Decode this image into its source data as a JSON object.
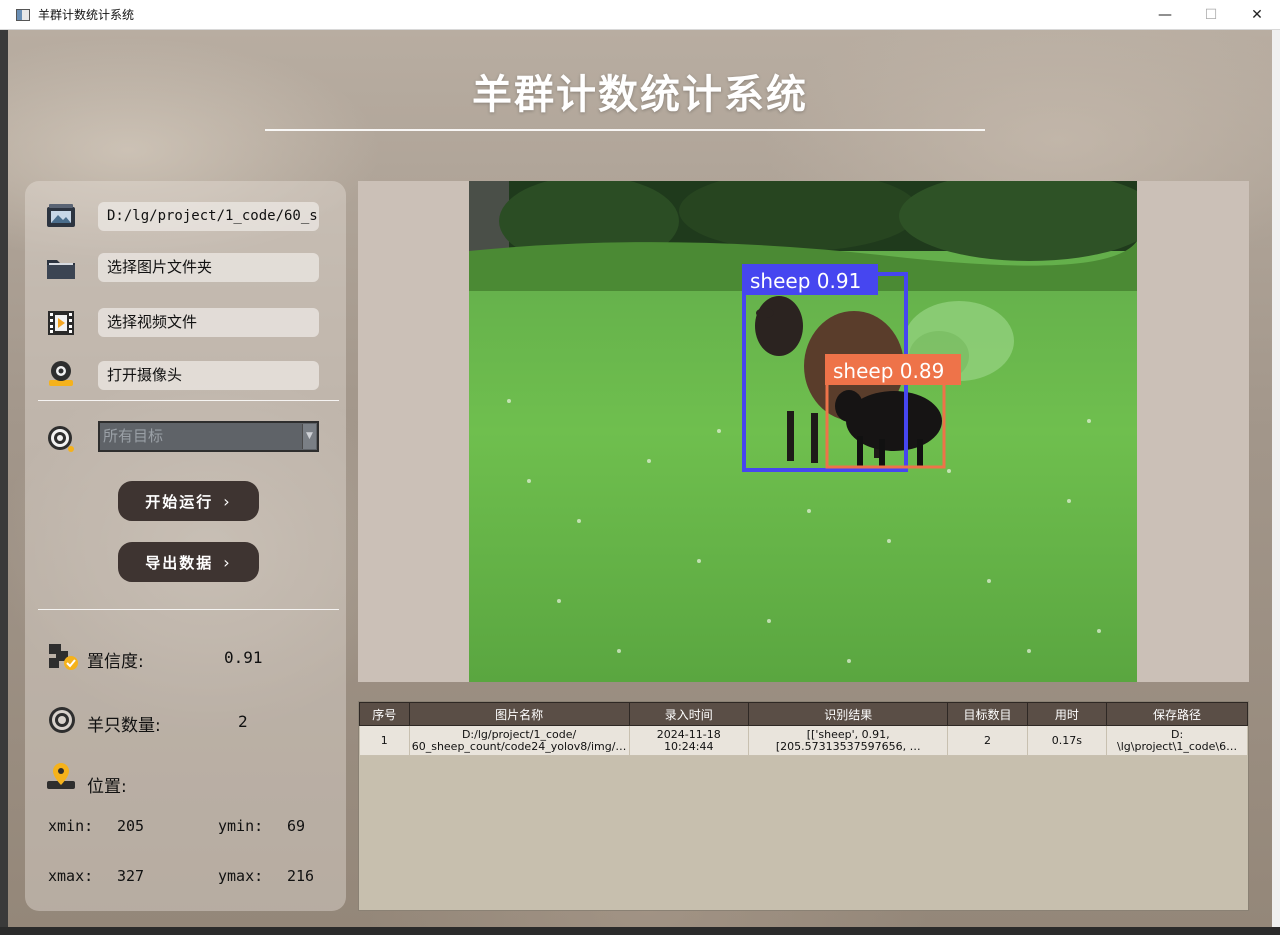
{
  "window": {
    "title": "羊群计数统计系统",
    "minimize": "—",
    "maximize": "☐",
    "close": "✕"
  },
  "header": {
    "title": "羊群计数统计系统"
  },
  "left_panel": {
    "image_path": "D:/lg/project/1_code/60_she",
    "select_image_folder": "选择图片文件夹",
    "select_video_file": "选择视频文件",
    "open_camera": "打开摄像头",
    "target_select": {
      "selected": "所有目标",
      "options": [
        "所有目标"
      ]
    },
    "start_button": "开始运行",
    "export_button": "导出数据",
    "confidence_label": "置信度:",
    "confidence_value": "0.91",
    "count_label": "羊只数量:",
    "count_value": "2",
    "position_label": "位置:",
    "xmin_label": "xmin:",
    "xmin_value": "205",
    "ymin_label": "ymin:",
    "ymin_value": "69",
    "xmax_label": "xmax:",
    "xmax_value": "327",
    "ymax_label": "ymax:",
    "ymax_value": "216"
  },
  "viewer": {
    "detections": [
      {
        "label": "sheep 0.91",
        "color": "#4646f0"
      },
      {
        "label": "sheep 0.89",
        "color": "#ee7349"
      }
    ]
  },
  "table": {
    "headers": [
      "序号",
      "图片名称",
      "录入时间",
      "识别结果",
      "目标数目",
      "用时",
      "保存路径"
    ],
    "rows": [
      {
        "index": "1",
        "name_line1": "D:/lg/project/1_code/",
        "name_line2": "60_sheep_count/code24_yolov8/img/…",
        "time_line1": "2024-11-18",
        "time_line2": "10:24:44",
        "result_line1": "[['sheep', 0.91,",
        "result_line2": "[205.57313537597656, …",
        "count": "2",
        "duration": "0.17s",
        "path_line1": "D:",
        "path_line2": "\\lg\\project\\1_code\\6…"
      }
    ]
  },
  "colors": {
    "button_bg": "#3e3431",
    "table_header_bg": "#5a4e46",
    "box_blue": "#4646f0",
    "box_orange": "#ee7349"
  }
}
